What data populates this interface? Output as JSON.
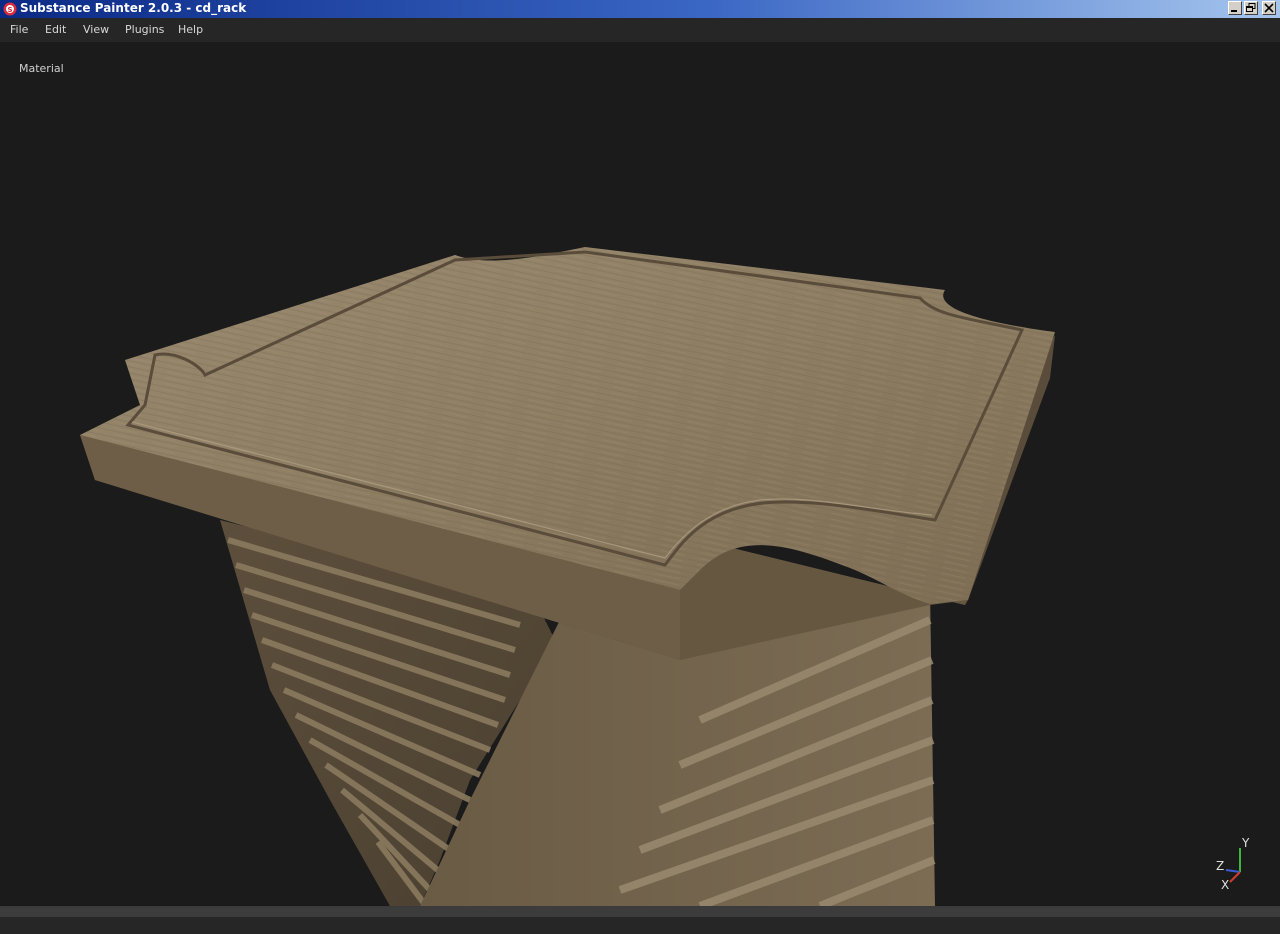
{
  "window": {
    "title": "Substance Painter 2.0.3 - cd_rack"
  },
  "window_controls": [
    "minimize-icon",
    "restore-icon",
    "close-icon"
  ],
  "menu": {
    "items": [
      "File",
      "Edit",
      "View",
      "Plugins",
      "Help"
    ]
  },
  "viewport": {
    "label": "Material",
    "model": "cd_rack",
    "background_color": "#1b1b1b"
  },
  "axis_gizmo": {
    "y_label": "Y",
    "z_label": "Z",
    "x_label": "X",
    "colors": {
      "y": "#3db63d",
      "z": "#3a5bd6",
      "x": "#d23c2f"
    }
  },
  "colors": {
    "titlebar_start": "#0b2a86",
    "titlebar_end": "#a6c6ee",
    "menubar": "#262626",
    "wood": "#8c7a60"
  }
}
